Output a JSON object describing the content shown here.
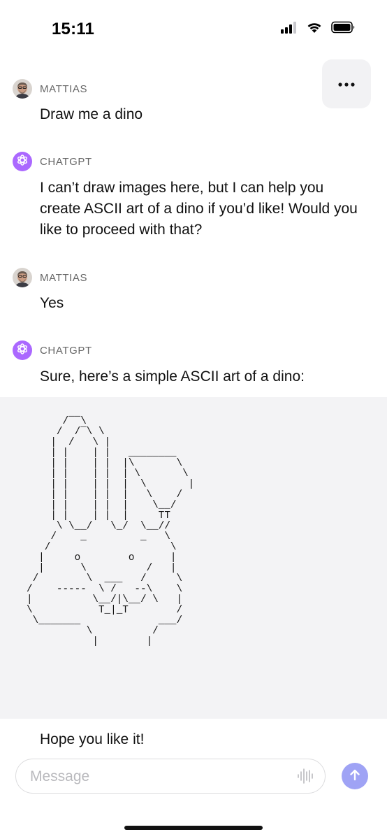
{
  "status_bar": {
    "time": "15:11",
    "icons": [
      "cellular-signal-icon",
      "wifi-icon",
      "battery-icon"
    ]
  },
  "header": {
    "more_icon": "ellipsis-icon"
  },
  "messages": [
    {
      "sender": "MATTIAS",
      "text": "Draw me a dino"
    },
    {
      "sender": "CHATGPT",
      "text": "I can’t draw images here, but I can help you create ASCII art of a dino if you’d like! Would you like to proceed with that?"
    },
    {
      "sender": "MATTIAS",
      "text": "Yes"
    },
    {
      "sender": "CHATGPT",
      "text": "Sure, here’s a simple ASCII art of a dino:"
    }
  ],
  "ascii_art": "      /‾‾\\\n     /  /‾\\ \\\n    |  /   \\ |\n    | |    | |   ________\n    | |    | |  |\\       \\\n    | |    | |  | \\       \\\n    | |    | |  |  \\       |\n    | |    | |  |   \\    /\n    | |    | |  |    \\__/\n    | |    | |  |     TT\n     \\ \\__/   \\_/  \\__//\n    /    _         _   \\\n   /                    \\\n  |     o        o      |\n  |      \\          /   |\n /        \\  ___   /     \\\n/    -----  \\ /   --\\    \\\n|          \\__/|\\__/ \\   |\n\\           T_|_T        /\n \\_______             ___/\n          \\          /\n           |        |",
  "closing_text": "Hope you like it!",
  "composer": {
    "placeholder": "Message",
    "value": ""
  },
  "colors": {
    "assistant_avatar": "#ab68ff",
    "send_button": "#9fa3f5",
    "code_background": "#f3f3f5",
    "ascii_accent": "#2a8a2a"
  }
}
